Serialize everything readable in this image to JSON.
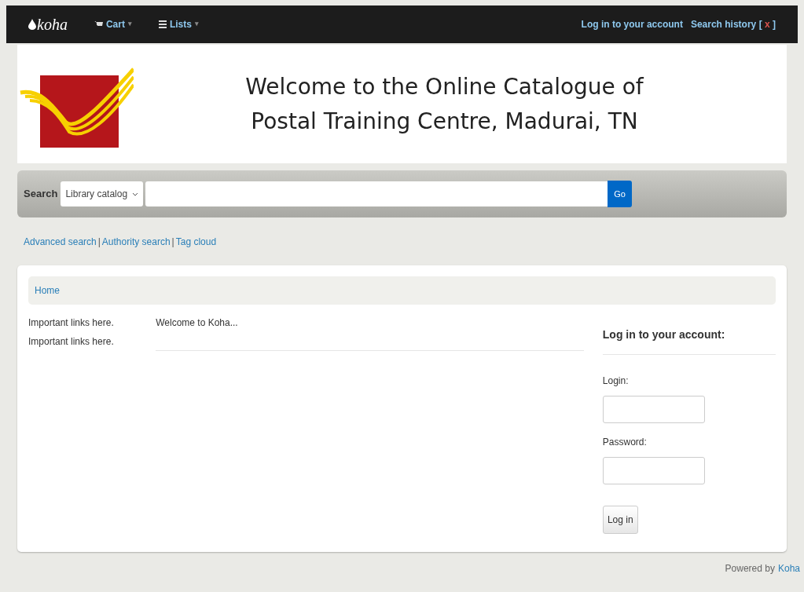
{
  "navbar": {
    "brand": "koha",
    "menus": [
      {
        "label": "Cart",
        "caret": "▾"
      },
      {
        "label": "Lists",
        "caret": "▾"
      }
    ],
    "login_link": "Log in to your account",
    "history": {
      "label": "Search history",
      "open": "[",
      "clear": "x",
      "close": "]"
    }
  },
  "header": {
    "title_lines": [
      "Welcome to the Online Catalogue of",
      "Postal Training Centre, Madurai, TN"
    ]
  },
  "search": {
    "label": "Search",
    "scope": "Library catalog",
    "button": "Go"
  },
  "links": [
    {
      "label": "Advanced search"
    },
    {
      "separator": "|",
      "label": "Authority search"
    },
    {
      "separator": "|",
      "label": "Tag cloud"
    }
  ],
  "breadcrumb": [
    "Home"
  ],
  "left_links": [
    "Important links here.",
    "Important links here."
  ],
  "news": "Welcome to Koha...",
  "login": {
    "heading": "Log in to your account:",
    "fields": [
      {
        "label": "Login:"
      },
      {
        "label": "Password:"
      }
    ],
    "button": "Log in"
  },
  "footer": {
    "text": "Powered by",
    "link": "Koha"
  }
}
